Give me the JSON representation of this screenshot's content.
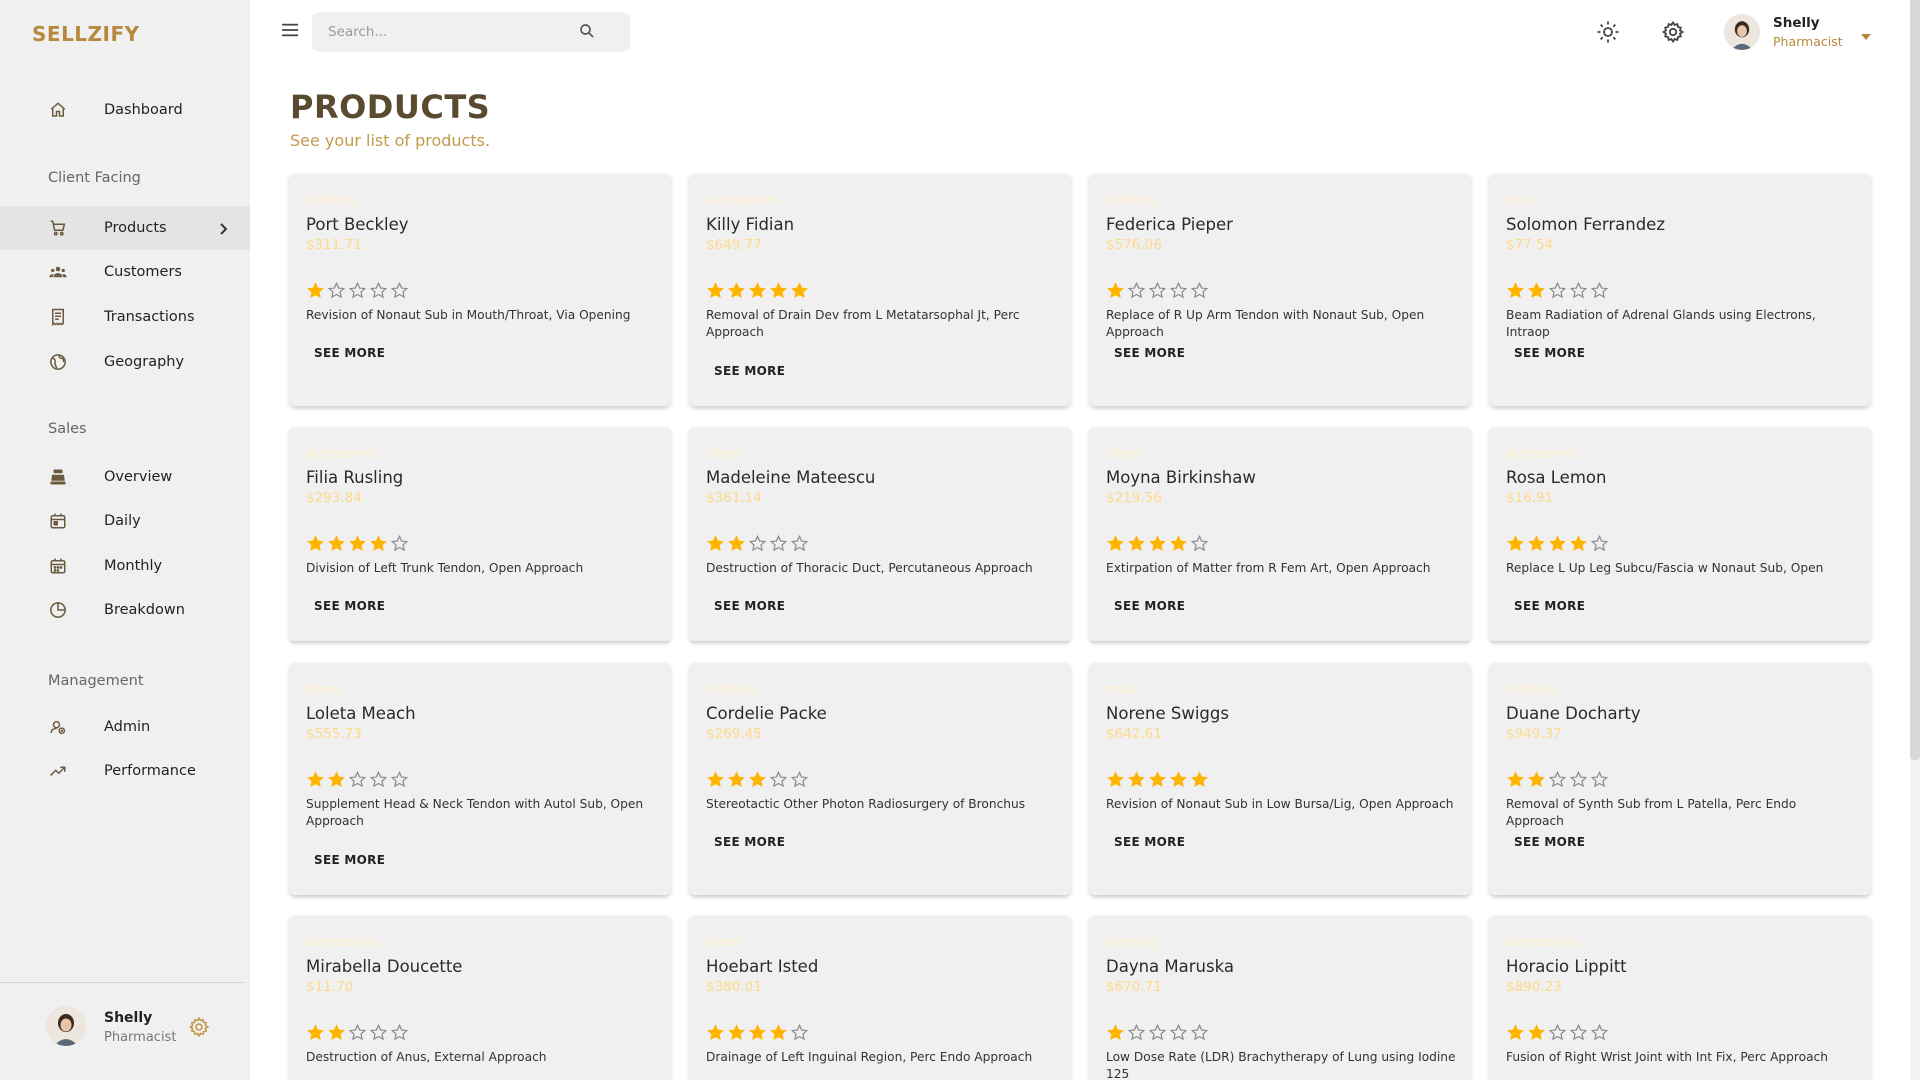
{
  "brand": "SELLZIFY",
  "search": {
    "placeholder": "Search..."
  },
  "user": {
    "name": "Shelly",
    "role": "Pharmacist"
  },
  "sidebar": {
    "items": [
      {
        "id": "dashboard",
        "label": "Dashboard",
        "icon": "home-icon"
      },
      {
        "section": "Client Facing"
      },
      {
        "id": "products",
        "label": "Products",
        "icon": "cart-icon",
        "active": true
      },
      {
        "id": "customers",
        "label": "Customers",
        "icon": "groups-icon"
      },
      {
        "id": "transactions",
        "label": "Transactions",
        "icon": "receipt-icon"
      },
      {
        "id": "geography",
        "label": "Geography",
        "icon": "globe-icon"
      },
      {
        "section": "Sales"
      },
      {
        "id": "overview",
        "label": "Overview",
        "icon": "point-of-sale-icon"
      },
      {
        "id": "daily",
        "label": "Daily",
        "icon": "today-icon"
      },
      {
        "id": "monthly",
        "label": "Monthly",
        "icon": "calendar-month-icon"
      },
      {
        "id": "breakdown",
        "label": "Breakdown",
        "icon": "pie-chart-icon"
      },
      {
        "section": "Management"
      },
      {
        "id": "admin",
        "label": "Admin",
        "icon": "admin-icon"
      },
      {
        "id": "performance",
        "label": "Performance",
        "icon": "trending-up-icon"
      }
    ]
  },
  "header": {
    "title": "PRODUCTS",
    "subtitle": "See your list of products."
  },
  "card_button_label": "SEE MORE",
  "colors": {
    "accent": "#c39a4a",
    "star": "#ffb400",
    "title": "#5a4a30"
  },
  "products": [
    {
      "category": "clothing",
      "name": "Port Beckley",
      "price": "$311.71",
      "rating": 1,
      "description": "Revision of Nonaut Sub in Mouth/Throat, Via Opening"
    },
    {
      "category": "accessories",
      "name": "Killy Fidian",
      "price": "$649.77",
      "rating": 5,
      "description": "Removal of Drain Dev from L Metatarsophal Jt, Perc Approach"
    },
    {
      "category": "clothing",
      "name": "Federica Pieper",
      "price": "$576.06",
      "rating": 1,
      "description": "Replace of R Up Arm Tendon with Nonaut Sub, Open Approach"
    },
    {
      "category": "misc",
      "name": "Solomon Ferrandez",
      "price": "$77.54",
      "rating": 2,
      "description": "Beam Radiation of Adrenal Glands using Electrons, Intraop"
    },
    {
      "category": "accessories",
      "name": "Filia Rusling",
      "price": "$293.84",
      "rating": 4,
      "description": "Division of Left Trunk Tendon, Open Approach"
    },
    {
      "category": "shoes",
      "name": "Madeleine Mateescu",
      "price": "$361.14",
      "rating": 2,
      "description": "Destruction of Thoracic Duct, Percutaneous Approach"
    },
    {
      "category": "shoes",
      "name": "Moyna Birkinshaw",
      "price": "$219.56",
      "rating": 4,
      "description": "Extirpation of Matter from R Fem Art, Open Approach"
    },
    {
      "category": "accessories",
      "name": "Rosa Lemon",
      "price": "$16.91",
      "rating": 4,
      "description": "Replace L Up Leg Subcu/Fascia w Nonaut Sub, Open"
    },
    {
      "category": "shoes",
      "name": "Loleta Meach",
      "price": "$555.73",
      "rating": 2,
      "description": "Supplement Head & Neck Tendon with Autol Sub, Open Approach"
    },
    {
      "category": "clothing",
      "name": "Cordelie Packe",
      "price": "$269.45",
      "rating": 3,
      "description": "Stereotactic Other Photon Radiosurgery of Bronchus"
    },
    {
      "category": "misc",
      "name": "Norene Swiggs",
      "price": "$642.61",
      "rating": 5,
      "description": "Revision of Nonaut Sub in Low Bursa/Lig, Open Approach"
    },
    {
      "category": "clothing",
      "name": "Duane Docharty",
      "price": "$949.37",
      "rating": 2,
      "description": "Removal of Synth Sub from L Patella, Perc Endo Approach"
    },
    {
      "category": "accessories",
      "name": "Mirabella Doucette",
      "price": "$11.70",
      "rating": 2,
      "description": "Destruction of Anus, External Approach"
    },
    {
      "category": "shoes",
      "name": "Hoebart Isted",
      "price": "$380.01",
      "rating": 4,
      "description": "Drainage of Left Inguinal Region, Perc Endo Approach"
    },
    {
      "category": "clothing",
      "name": "Dayna Maruska",
      "price": "$670.71",
      "rating": 1,
      "description": "Low Dose Rate (LDR) Brachytherapy of Lung using Iodine 125"
    },
    {
      "category": "accessories",
      "name": "Horacio Lippitt",
      "price": "$890.23",
      "rating": 2,
      "description": "Fusion of Right Wrist Joint with Int Fix, Perc Approach"
    }
  ]
}
